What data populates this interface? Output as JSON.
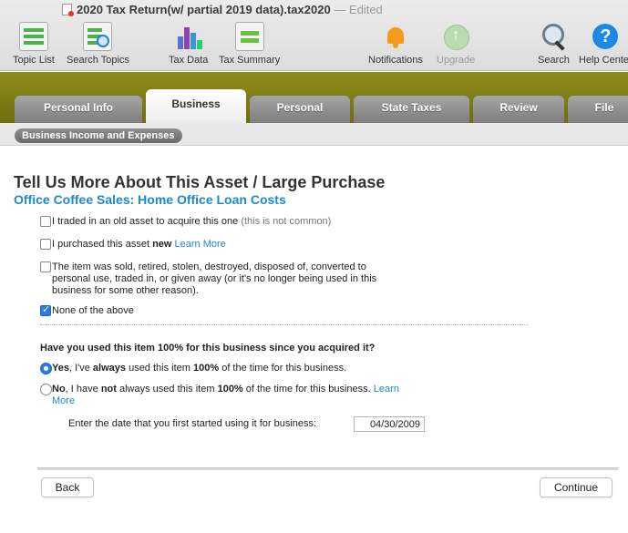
{
  "window": {
    "title": "2020 Tax Return(w/ partial 2019 data).tax2020",
    "separator": "—",
    "status": "Edited"
  },
  "toolbar": {
    "topic_list": "Topic List",
    "search_topics": "Search Topics",
    "tax_data": "Tax Data",
    "tax_summary": "Tax Summary",
    "notifications": "Notifications",
    "upgrade": "Upgrade",
    "search": "Search",
    "help_center": "Help Center"
  },
  "tabs": {
    "personal_info": "Personal Info",
    "business": "Business",
    "personal": "Personal",
    "state_taxes": "State Taxes",
    "review": "Review",
    "file": "File"
  },
  "subtab": "Business Income and Expenses",
  "page": {
    "heading": "Tell Us More About This Asset / Large Purchase",
    "subheading": "Office Coffee Sales: Home Office Loan Costs",
    "options": {
      "traded": {
        "label": "I traded in an old asset to acquire this one",
        "note": "(this is not common)",
        "checked": false
      },
      "purchased": {
        "label": " I purchased this asset ",
        "bold": "new",
        "link": "Learn More",
        "checked": false
      },
      "sold": {
        "line1": "The item was sold, retired, stolen, destroyed, disposed of, converted to",
        "line2": "personal use, traded in, or given away (or it's no longer being used in this",
        "line3": "business for some other reason).",
        "checked": false
      },
      "none": {
        "label": "None of the above",
        "checked": true
      }
    },
    "question": "Have you used this item 100% for this business since you acquired it?",
    "yes": {
      "lead": "Yes",
      "t1": ", I've ",
      "b1": "always",
      "t2": " used this item ",
      "b2": "100%",
      "t3": " of the time for this business.",
      "selected": true
    },
    "no": {
      "lead": "No",
      "t1": ", I have ",
      "b1": "not",
      "t2": " always used this item ",
      "b2": "100%",
      "t3": " of the time for this business. ",
      "link1": "Learn",
      "link2": "More",
      "selected": false
    },
    "date_label": "Enter the date that you first started using it for business:",
    "date_value": "04/30/2009"
  },
  "buttons": {
    "back": "Back",
    "continue": "Continue"
  },
  "colors": {
    "tab_band": "#7e7e16",
    "accent_blue": "#1e88c8",
    "checkbox_blue": "#2d7ce0"
  }
}
